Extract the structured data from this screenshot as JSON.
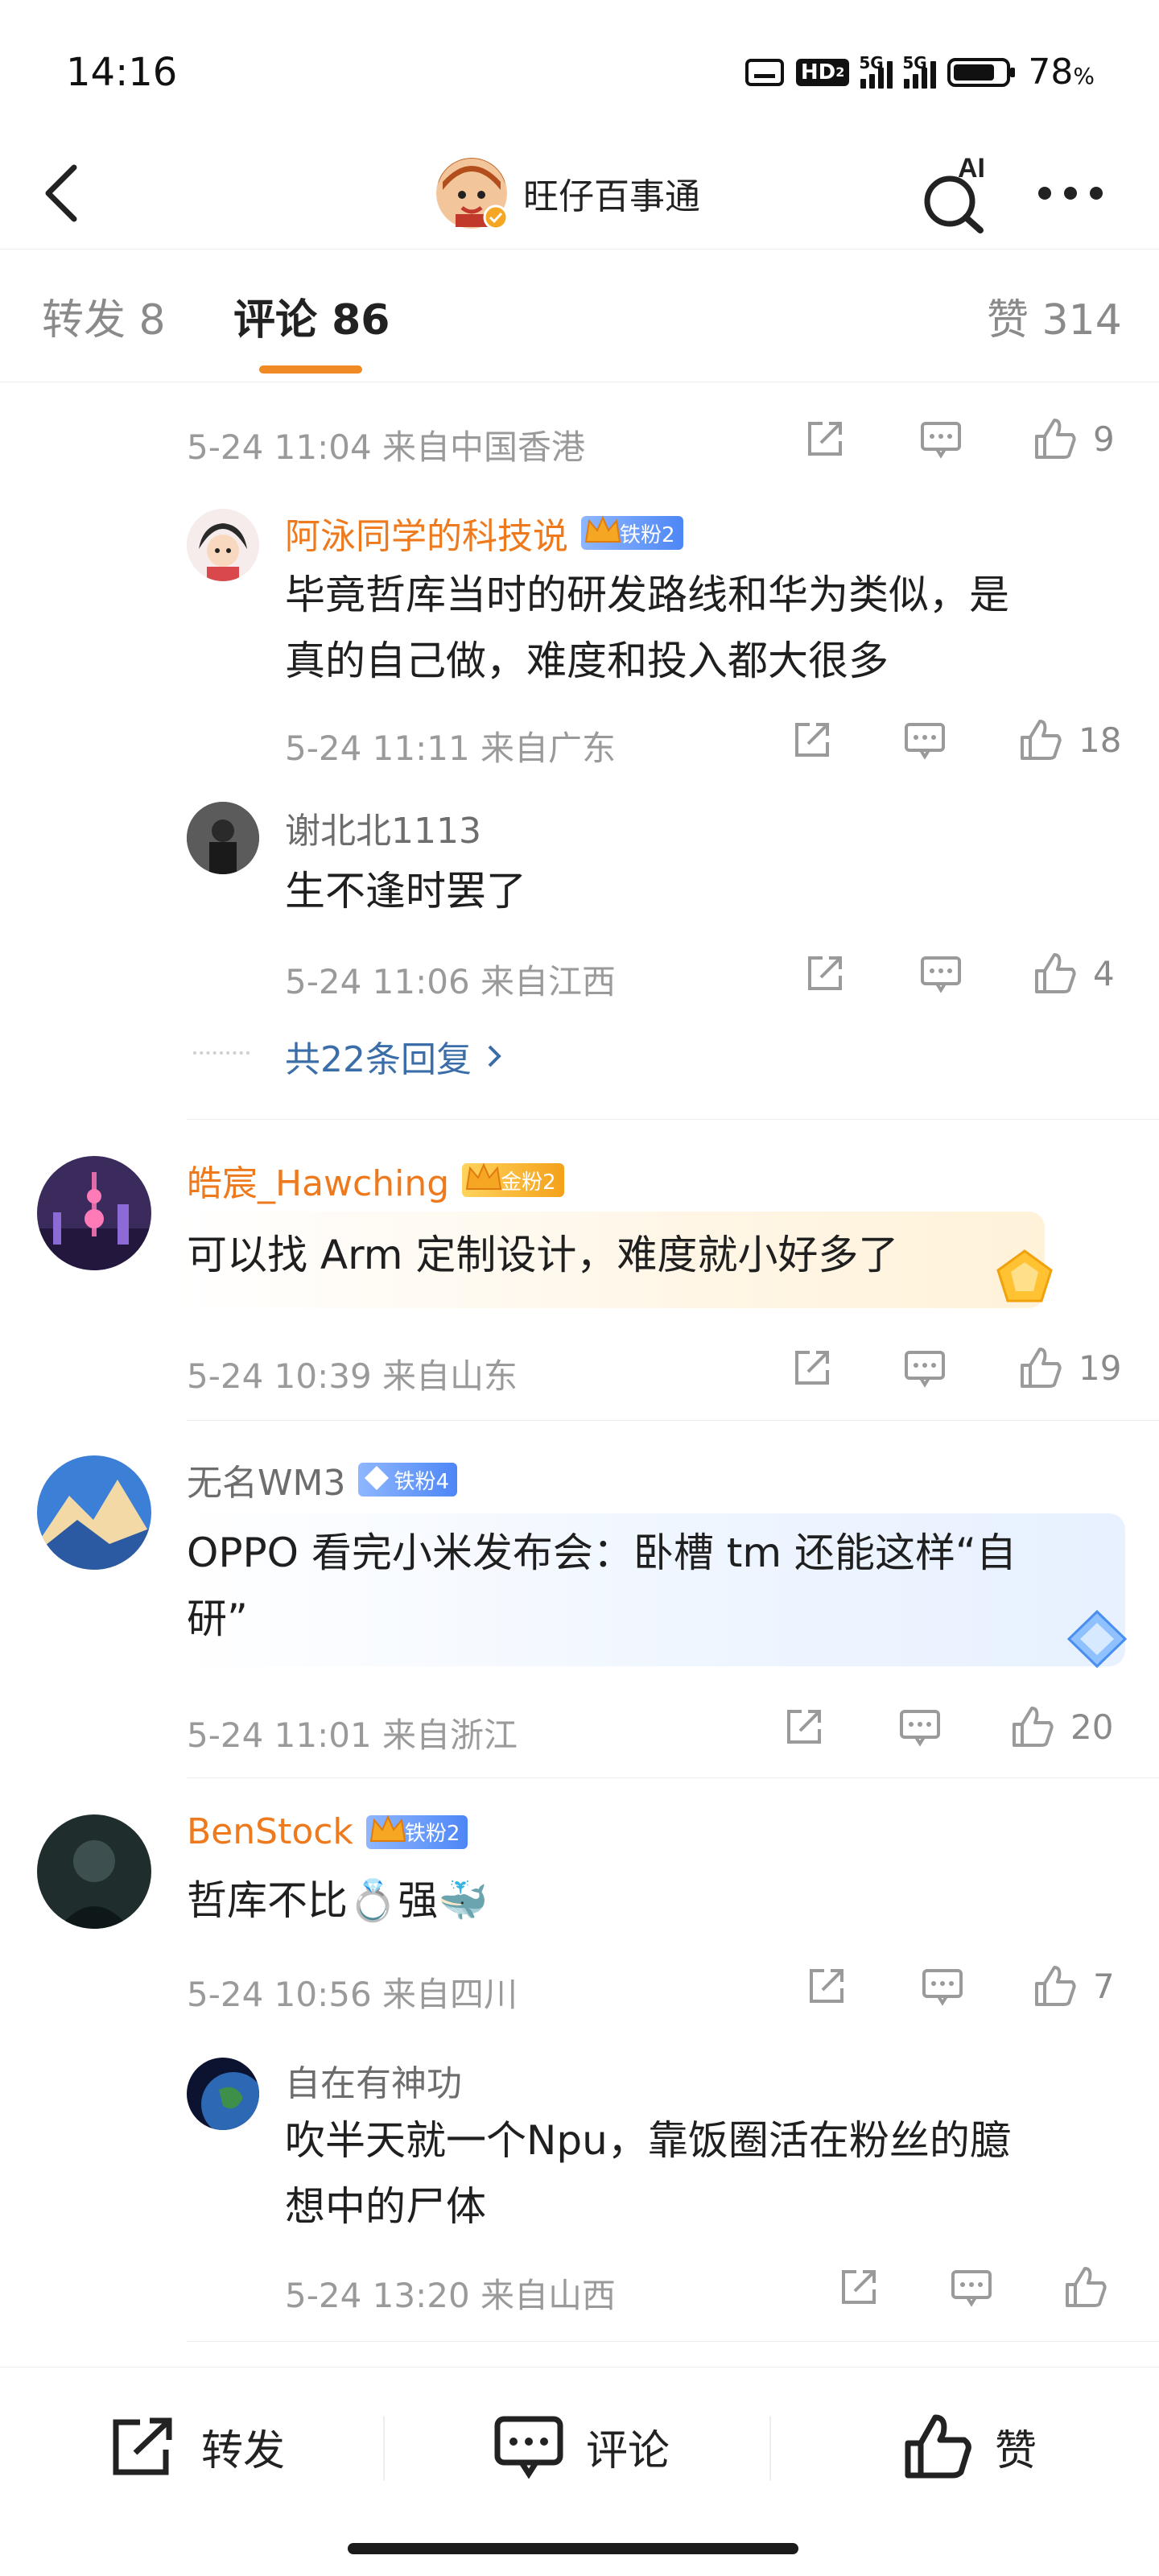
{
  "status": {
    "time": "14:16",
    "hd": "HD",
    "hd_sub": "2",
    "net1": "5G",
    "net2": "5G",
    "battery": "78",
    "battery_unit": "%"
  },
  "header": {
    "title": "旺仔百事通",
    "ai_label": "AI"
  },
  "tabs": [
    {
      "label": "转发 8"
    },
    {
      "label": "评论 86"
    },
    {
      "label": "赞 314"
    }
  ],
  "comments": [
    {
      "meta": "5-24 11:04  来自中国香港",
      "likes": "9",
      "replies": [
        {
          "name": "阿泳同学的科技说",
          "badge": "铁粉2",
          "text_line1": "毕竟哲库当时的研发路线和华为类似，是",
          "text_line2": "真的自己做，难度和投入都大很多",
          "meta": "5-24 11:11  来自广东",
          "likes": "18"
        },
        {
          "name": "谢北北1113",
          "text_line1": "生不逢时罢了",
          "meta": "5-24 11:06  来自江西",
          "likes": "4"
        }
      ],
      "more_replies": "共22条回复"
    },
    {
      "name": "皓宸_Hawching",
      "badge": "金粉2",
      "text_line1": "可以找 Arm 定制设计，难度就小好多了",
      "meta": "5-24 10:39  来自山东",
      "likes": "19"
    },
    {
      "name": "无名WM3",
      "badge": "铁粉4",
      "text_line1": "OPPO 看完小米发布会：卧槽 tm 还能这样“自",
      "text_line2": "研”",
      "meta": "5-24 11:01  来自浙江",
      "likes": "20"
    },
    {
      "name": "BenStock",
      "badge": "铁粉2",
      "text_line1": "哲库不比💍强🐳",
      "meta": "5-24 10:56  来自四川",
      "likes": "7",
      "replies": [
        {
          "name": "自在有神功",
          "text_line1": "吹半天就一个Npu，靠饭圈活在粉丝的臆",
          "text_line2": "想中的尸体",
          "meta": "5-24 13:20  来自山西",
          "likes": ""
        }
      ]
    }
  ],
  "bottom_bar": {
    "repost": "转发",
    "comment": "评论",
    "like": "赞"
  },
  "colors": {
    "accent_orange": "#f08a24",
    "username_orange": "#ee7a1d",
    "link_blue": "#3b6ea8"
  }
}
